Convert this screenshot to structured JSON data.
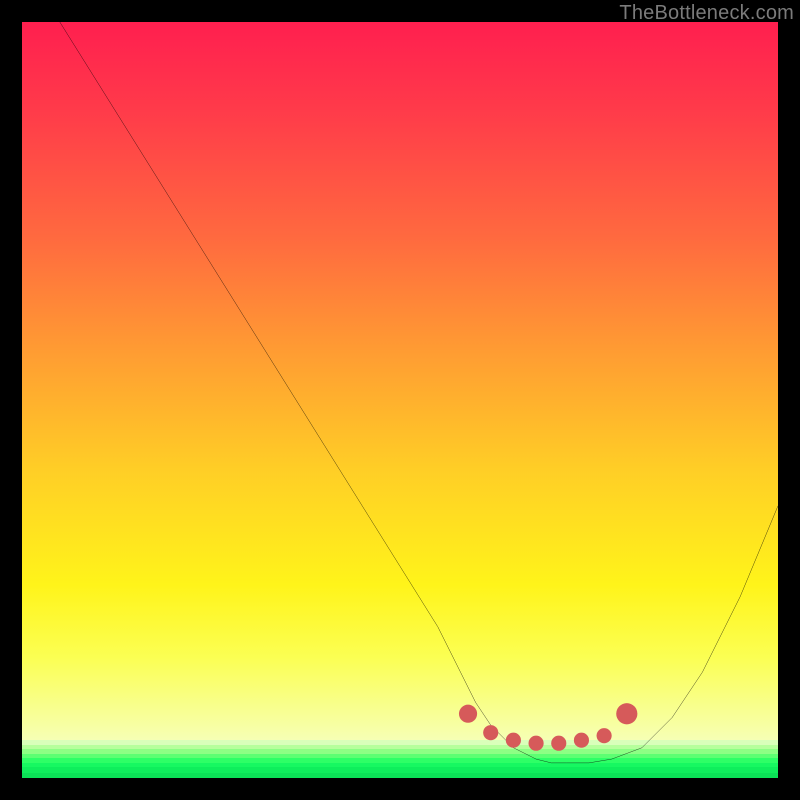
{
  "watermark": "TheBottleneck.com",
  "gradient": {
    "stops": [
      {
        "pos": 0.0,
        "color": "#ff1f4f"
      },
      {
        "pos": 0.12,
        "color": "#ff3a4a"
      },
      {
        "pos": 0.3,
        "color": "#ff6a3f"
      },
      {
        "pos": 0.45,
        "color": "#ff9a33"
      },
      {
        "pos": 0.62,
        "color": "#ffce26"
      },
      {
        "pos": 0.78,
        "color": "#fff41a"
      },
      {
        "pos": 0.88,
        "color": "#fbff53"
      },
      {
        "pos": 1.0,
        "color": "#f6ffb9"
      }
    ],
    "green_bands": [
      {
        "bottom_pct": 4.4,
        "height_pct": 0.6,
        "color": "#d9ffba"
      },
      {
        "bottom_pct": 3.8,
        "height_pct": 0.6,
        "color": "#b6ff9c"
      },
      {
        "bottom_pct": 3.2,
        "height_pct": 0.6,
        "color": "#8dff84"
      },
      {
        "bottom_pct": 2.6,
        "height_pct": 0.6,
        "color": "#5cff72"
      },
      {
        "bottom_pct": 2.0,
        "height_pct": 0.6,
        "color": "#2eff66"
      },
      {
        "bottom_pct": 1.4,
        "height_pct": 0.6,
        "color": "#17f861"
      },
      {
        "bottom_pct": 0.7,
        "height_pct": 0.7,
        "color": "#0fee5c"
      },
      {
        "bottom_pct": 0.0,
        "height_pct": 0.7,
        "color": "#0be257"
      }
    ]
  },
  "chart_data": {
    "type": "line",
    "title": "",
    "xlabel": "",
    "ylabel": "",
    "xlim": [
      0,
      100
    ],
    "ylim": [
      0,
      100
    ],
    "grid": false,
    "series": [
      {
        "name": "bottleneck-curve",
        "color": "#000000",
        "x": [
          5,
          10,
          15,
          20,
          25,
          30,
          35,
          40,
          45,
          50,
          55,
          58,
          60,
          62,
          65,
          68,
          70,
          72,
          75,
          78,
          82,
          86,
          90,
          95,
          100
        ],
        "y": [
          100,
          92,
          84,
          76,
          68,
          60,
          52,
          44,
          36,
          28,
          20,
          14,
          10,
          7,
          4,
          2.5,
          2,
          2,
          2,
          2.5,
          4,
          8,
          14,
          24,
          36
        ]
      }
    ],
    "markers": [
      {
        "name": "flat-dot-start",
        "x": 59,
        "y": 8.5,
        "r": 1.2,
        "color": "#d65a5a"
      },
      {
        "name": "flat-dot-a",
        "x": 62,
        "y": 6.0,
        "r": 1.0,
        "color": "#d65a5a"
      },
      {
        "name": "flat-dot-b",
        "x": 65,
        "y": 5.0,
        "r": 1.0,
        "color": "#d65a5a"
      },
      {
        "name": "flat-dot-c",
        "x": 68,
        "y": 4.6,
        "r": 1.0,
        "color": "#d65a5a"
      },
      {
        "name": "flat-dot-d",
        "x": 71,
        "y": 4.6,
        "r": 1.0,
        "color": "#d65a5a"
      },
      {
        "name": "flat-dot-e",
        "x": 74,
        "y": 5.0,
        "r": 1.0,
        "color": "#d65a5a"
      },
      {
        "name": "flat-dot-f",
        "x": 77,
        "y": 5.6,
        "r": 1.0,
        "color": "#d65a5a"
      },
      {
        "name": "flat-dot-end",
        "x": 80,
        "y": 8.5,
        "r": 1.4,
        "color": "#d65a5a"
      }
    ]
  }
}
